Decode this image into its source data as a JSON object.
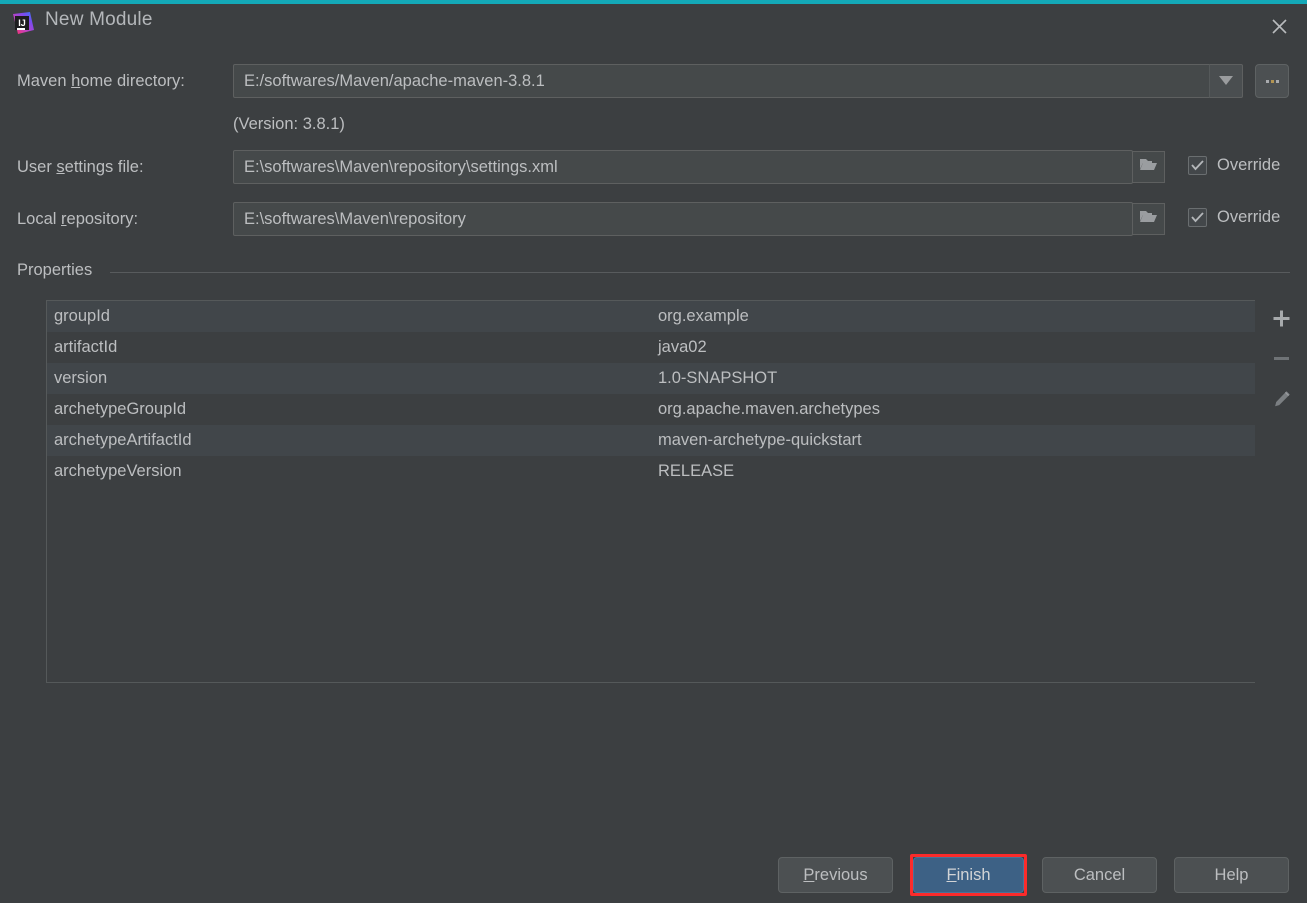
{
  "window": {
    "title": "New Module",
    "app_icon": "intellij-idea-icon",
    "close_icon": "close-icon",
    "accent_color": "#14a9b8",
    "background_color": "#3c3f41"
  },
  "form": {
    "maven_home": {
      "label_before": "Maven ",
      "label_mnemonic": "h",
      "label_after": "ome directory:",
      "value": "E:/softwares/Maven/apache-maven-3.8.1",
      "dropdown_icon": "chevron-down-icon",
      "browse_label": "...",
      "browse_icon": "ellipsis-icon"
    },
    "version_note": "(Version: 3.8.1)",
    "user_settings": {
      "label_before": "User ",
      "label_mnemonic": "s",
      "label_after": "ettings file:",
      "value": "E:\\softwares\\Maven\\repository\\settings.xml",
      "folder_icon": "folder-icon",
      "override_label": "Override",
      "override_checked": true
    },
    "local_repository": {
      "label_before": "Local ",
      "label_mnemonic": "r",
      "label_after": "epository:",
      "value": "E:\\softwares\\Maven\\repository",
      "folder_icon": "folder-icon",
      "override_label": "Override",
      "override_checked": true
    }
  },
  "properties": {
    "section_label": "Properties",
    "rows": [
      {
        "key": "groupId",
        "value": "org.example"
      },
      {
        "key": "artifactId",
        "value": "java02"
      },
      {
        "key": "version",
        "value": "1.0-SNAPSHOT"
      },
      {
        "key": "archetypeGroupId",
        "value": "org.apache.maven.archetypes"
      },
      {
        "key": "archetypeArtifactId",
        "value": "maven-archetype-quickstart"
      },
      {
        "key": "archetypeVersion",
        "value": "RELEASE"
      }
    ],
    "toolbar": {
      "add_icon": "plus-icon",
      "remove_icon": "minus-icon",
      "edit_icon": "pencil-icon"
    }
  },
  "footer": {
    "previous": {
      "before": "",
      "mnemonic": "P",
      "after": "revious"
    },
    "finish": {
      "before": "",
      "mnemonic": "F",
      "after": "inish",
      "is_default": true,
      "highlight_color": "#fb2b2b"
    },
    "cancel": {
      "before": "Cancel",
      "mnemonic": "",
      "after": ""
    },
    "help": {
      "before": "Help",
      "mnemonic": "",
      "after": ""
    }
  }
}
